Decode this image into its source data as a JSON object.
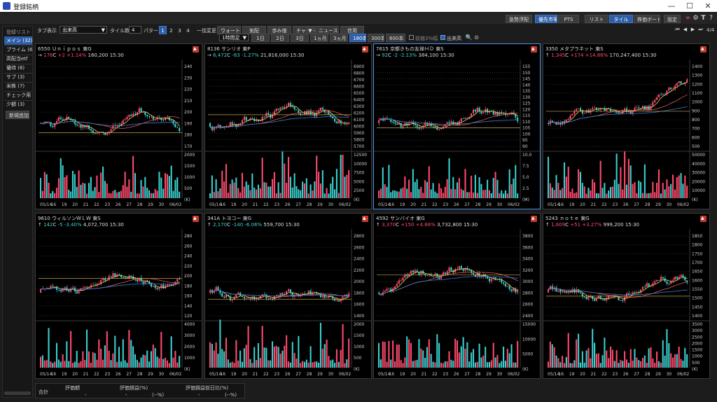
{
  "app": {
    "title": "登録銘柄"
  },
  "window_controls": {
    "minimize": "—",
    "maximize": "☐",
    "close": "✕"
  },
  "top_buttons": {
    "hot_stocks": "急勢浮配",
    "priority_market": "優先市場",
    "pts": "PTS",
    "list": "リスト",
    "tile": "タイル",
    "board": "株価ボード",
    "settings": "設定"
  },
  "sidebar": {
    "header": "登録リスト",
    "items": [
      {
        "label": "メイン (32)",
        "active": true
      },
      {
        "label": "プライム (6)"
      },
      {
        "label": "高配当etf"
      },
      {
        "label": "優待 (6)"
      },
      {
        "label": "サブ (3)"
      },
      {
        "label": "米株 (7)"
      },
      {
        "label": "チェック用 ("
      },
      {
        "label": "少額 (3)"
      }
    ],
    "add_new": "新規追加"
  },
  "toolbar1": {
    "tab_display_label": "タブ表示",
    "tab_display_value": "出来高",
    "tile_count_label": "タイル数",
    "tile_count_value": "4",
    "pattern_label": "パターン",
    "patterns": [
      "1",
      "2",
      "3",
      "4"
    ],
    "bulk_change_label": "一括変更",
    "quote": "ウォート",
    "board": "気配",
    "position": "歩み値",
    "chart": "チャート",
    "dropdown": "▼",
    "news": "ニュース",
    "credit": "信用",
    "page": "4/4"
  },
  "toolbar2": {
    "interval_value": "1時間足",
    "ranges": [
      "1日",
      "2日",
      "3日",
      "1ヵ月",
      "3ヵ月",
      "180本",
      "300本",
      "600本"
    ],
    "ma_checkbox": "前値3%幅",
    "volume_checkbox": "出来高"
  },
  "dates": [
    "05/14",
    "16",
    "19",
    "20",
    "21",
    "22",
    "23",
    "26",
    "27",
    "28",
    "29",
    "30",
    "06/02"
  ],
  "panels": [
    {
      "code": "6550",
      "name": "Ｕｎｉｐｏｓ",
      "market": "東G",
      "arrow": "→",
      "price": "178",
      "cflag": "C",
      "change": "+2",
      "pct": "+1.14%",
      "volume": "160,200",
      "time": "15:30",
      "dir": "up",
      "y_ticks": [
        "240",
        "230",
        "220",
        "210",
        "200",
        "190",
        "180",
        "170"
      ],
      "v_ticks": [
        "2000",
        "1500",
        "1000",
        "500",
        "(K)"
      ],
      "y_range": [
        165,
        245
      ],
      "v_max": 2200,
      "seed": 11
    },
    {
      "code": "8136",
      "name": "サンリオ",
      "market": "東P",
      "arrow": "→",
      "price": "6,472",
      "cflag": "C",
      "change": "-83",
      "pct": "-1.27%",
      "volume": "21,816,000",
      "time": "15:30",
      "dir": "down",
      "y_ticks": [
        "6900",
        "6800",
        "6700",
        "6600",
        "6500",
        "6400",
        "6300",
        "6200",
        "6100",
        "6000",
        "5900",
        "5800",
        "5700"
      ],
      "v_ticks": [
        "12500",
        "10000",
        "7500",
        "5000",
        "2500",
        "(K)"
      ],
      "y_range": [
        5650,
        6950
      ],
      "v_max": 13000,
      "seed": 23
    },
    {
      "code": "7615",
      "name": "京都きもの友禅ＨＤ",
      "market": "東S",
      "arrow": "→",
      "price": "92",
      "cflag": "C",
      "change": "-2",
      "pct": "-2.13%",
      "volume": "384,100",
      "time": "15:30",
      "dir": "down",
      "y_ticks": [
        "155",
        "150",
        "145",
        "140",
        "135",
        "130",
        "125",
        "120",
        "115",
        "110",
        "105",
        "100",
        "95",
        "90"
      ],
      "v_ticks": [
        "10.0",
        "7.5",
        "5.0",
        "2.5",
        "(M)"
      ],
      "y_range": [
        88,
        157
      ],
      "v_max": 10.5,
      "seed": 37
    },
    {
      "code": "3350",
      "name": "メタプラネット",
      "market": "東S",
      "arrow": "↑",
      "price": "1,345",
      "cflag": "C",
      "change": "+174",
      "pct": "+14.86%",
      "volume": "170,247,400",
      "time": "15:30",
      "dir": "up",
      "y_ticks": [
        "1400",
        "1300",
        "1200",
        "1100",
        "1000",
        "900",
        "800",
        "700",
        "600",
        "500"
      ],
      "v_ticks": [
        "50000",
        "40000",
        "30000",
        "20000",
        "10000",
        "(K)"
      ],
      "y_range": [
        450,
        1450
      ],
      "v_max": 52000,
      "seed": 41
    },
    {
      "code": "9610",
      "name": "ウィルソンＷＬＷ",
      "market": "東S",
      "arrow": "↑",
      "price": "142",
      "cflag": "C",
      "change": "-5",
      "pct": "-3.40%",
      "volume": "4,072,700",
      "time": "15:30",
      "dir": "down",
      "y_ticks": [
        "280",
        "260",
        "240",
        "220",
        "200",
        "180",
        "160",
        "140",
        "120"
      ],
      "v_ticks": [
        "4000",
        "3000",
        "2000",
        "1000",
        "(K)"
      ],
      "y_range": [
        115,
        290
      ],
      "v_max": 4300,
      "seed": 53
    },
    {
      "code": "341A",
      "name": "トヨコー",
      "market": "東G",
      "arrow": "↑",
      "price": "2,170",
      "cflag": "C",
      "change": "-140",
      "pct": "-6.06%",
      "volume": "559,700",
      "time": "15:30",
      "dir": "down",
      "y_ticks": [
        "2800",
        "2600",
        "2400",
        "2200",
        "2000",
        "1800",
        "1600",
        "1400"
      ],
      "v_ticks": [
        "2000",
        "1500",
        "1000",
        "500",
        "(K)"
      ],
      "y_range": [
        1350,
        2850
      ],
      "v_max": 2100,
      "seed": 67
    },
    {
      "code": "4592",
      "name": "サンバイオ",
      "market": "東G",
      "arrow": "↑",
      "price": "3,370",
      "cflag": "C",
      "change": "+150",
      "pct": "+4.66%",
      "volume": "3,732,800",
      "time": "15:30",
      "dir": "up",
      "y_ticks": [
        "3800",
        "3600",
        "3400",
        "3200",
        "3000",
        "2800",
        "2600",
        "2400"
      ],
      "v_ticks": [
        "15000",
        "10000",
        "5000",
        "(K)"
      ],
      "y_range": [
        2350,
        3900
      ],
      "v_max": 16000,
      "seed": 71
    },
    {
      "code": "5243",
      "name": "ｎｏｔｅ",
      "market": "東G",
      "arrow": "↑",
      "price": "1,609",
      "cflag": "C",
      "change": "+51",
      "pct": "+3.27%",
      "volume": "999,200",
      "time": "15:30",
      "dir": "up",
      "y_ticks": [
        "1850",
        "1800",
        "1750",
        "1700",
        "1650",
        "1600",
        "1550",
        "1500",
        "1450",
        "1400"
      ],
      "v_ticks": [
        "3500",
        "3000",
        "2500",
        "2000",
        "1500",
        "1000",
        "500",
        "(K)"
      ],
      "y_range": [
        1380,
        1880
      ],
      "v_max": 3600,
      "seed": 83
    }
  ],
  "summary": {
    "total_label": "合計",
    "eval_amount_label": "評価額",
    "eval_pl_label": "評価損益(%)",
    "eval_prev_label": "評価損益前日比(%)",
    "eval_amount_value": "-",
    "eval_pl_value": "-",
    "eval_pl_pct": "(--%)",
    "eval_prev_value": "-",
    "eval_prev_pct": "(--%)"
  },
  "colors": {
    "up": "#ff4a6e",
    "down": "#3ad1cf",
    "accent": "#2d5ea8"
  }
}
